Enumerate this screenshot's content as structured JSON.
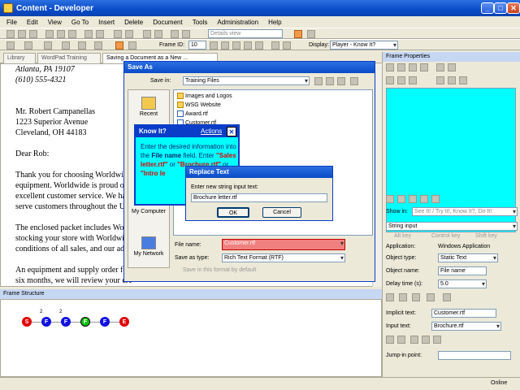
{
  "window": {
    "title": "Content - Developer",
    "min": "_",
    "max": "□",
    "close": "✕"
  },
  "menu": [
    "File",
    "Edit",
    "View",
    "Go To",
    "Insert",
    "Delete",
    "Document",
    "Tools",
    "Administration",
    "Help"
  ],
  "toolbar": {
    "frame_id_label": "Frame ID:",
    "frame_id_value": "10",
    "view_combo": "Details view",
    "display_label": "Display:",
    "display_value": "Player - Know It?"
  },
  "tabs": [
    {
      "label": "Library"
    },
    {
      "label": "WordPad Training"
    },
    {
      "label": "Saving a Document as a New ..."
    }
  ],
  "letter": {
    "lines": [
      "Atlanta, PA 19107",
      "(610) 555-4321",
      "",
      "Mr. Robert Campanellas",
      "1223 Superior Avenue",
      "Cleveland, OH  44183",
      "",
      "Dear Rob:",
      "",
      "Thank you for choosing Worldwide",
      "equipment. Worldwide is proud of",
      "excellent customer service. We hav",
      "serve customers throughout the Un",
      "",
      "The enclosed packet includes Work",
      "stocking your store with Worldwid",
      "conditions of all sales, and our adv",
      "",
      "An equipment and supply order for",
      "six months, we will review your cre"
    ]
  },
  "frame_structure": {
    "title": "Frame Structure",
    "nodes": [
      "S",
      "F",
      "F",
      "F",
      "F",
      "E"
    ],
    "badges": [
      "2",
      "2"
    ]
  },
  "frame_properties": {
    "title": "Frame Properties",
    "show_in_label": "Show in:",
    "show_in_value": "See It! / Try It!, Know It?, Do It!",
    "action_value": "String input",
    "alt_key": "Alt key",
    "control_key": "Control key",
    "shift_key": "Shift key",
    "application_label": "Application:",
    "application_value": "Windows Application",
    "object_type_label": "Object type:",
    "object_type_value": "Static Text",
    "object_name_label": "Object name:",
    "object_name_value": "File name",
    "delay_label": "Delay time (s):",
    "delay_value": "5.0",
    "implicit_label": "Implicit text:",
    "implicit_value": "Customer.rtf",
    "input_label": "Input text:",
    "input_value": "Brochure.rtf",
    "jump_label": "Jump-in point:"
  },
  "save_as": {
    "title": "Save As",
    "save_in_label": "Save in:",
    "save_in_value": "Training Files",
    "places": [
      {
        "label": "Recent"
      },
      {
        "label": "M"
      },
      {
        "label": "My Computer"
      },
      {
        "label": "My Network"
      }
    ],
    "files": [
      "Images and Logos",
      "WSG Website",
      "Award.rtf",
      "Customer.rtf"
    ],
    "file_name_label": "File name:",
    "file_name_value": "Customer.rtf",
    "save_type_label": "Save as type:",
    "save_type_value": "Rich Text Format (RTF)",
    "default_label": "Save in this format by default"
  },
  "know_it": {
    "title": "Know It?",
    "actions": "Actions",
    "text1": "Enter the desired information into the ",
    "bold1": "File name",
    "text2": " field. Enter ",
    "red1": "\"Sales letter.rtf\"",
    "text3": " or ",
    "red2": "\"Brochure.rtf\"",
    "text4": " or ",
    "red3": "\"Intro le",
    "close": "✕"
  },
  "replace_text": {
    "title": "Replace Text",
    "prompt": "Enter new string input text:",
    "value": "Brochure letter.rtf",
    "ok": "OK",
    "cancel": "Cancel"
  },
  "status": {
    "online": "Online"
  }
}
